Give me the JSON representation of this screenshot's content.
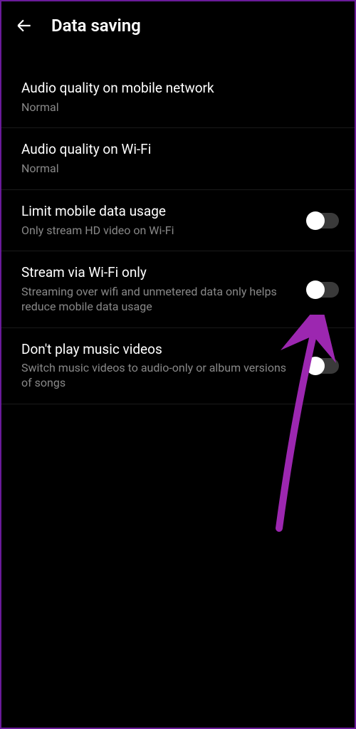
{
  "header": {
    "title": "Data saving"
  },
  "settings": [
    {
      "title": "Audio quality on mobile network",
      "subtitle": "Normal",
      "hasToggle": false
    },
    {
      "title": "Audio quality on Wi-Fi",
      "subtitle": "Normal",
      "hasToggle": false
    },
    {
      "title": "Limit mobile data usage",
      "subtitle": "Only stream HD video on Wi-Fi",
      "hasToggle": true,
      "toggleOn": false
    },
    {
      "title": "Stream via Wi-Fi only",
      "subtitle": "Streaming over wifi and unmetered data only helps reduce mobile data usage",
      "hasToggle": true,
      "toggleOn": false
    },
    {
      "title": "Don't play music videos",
      "subtitle": "Switch music videos to audio-only or album versions of songs",
      "hasToggle": true,
      "toggleOn": false
    }
  ],
  "annotation": {
    "arrowColor": "#9c27b0"
  }
}
